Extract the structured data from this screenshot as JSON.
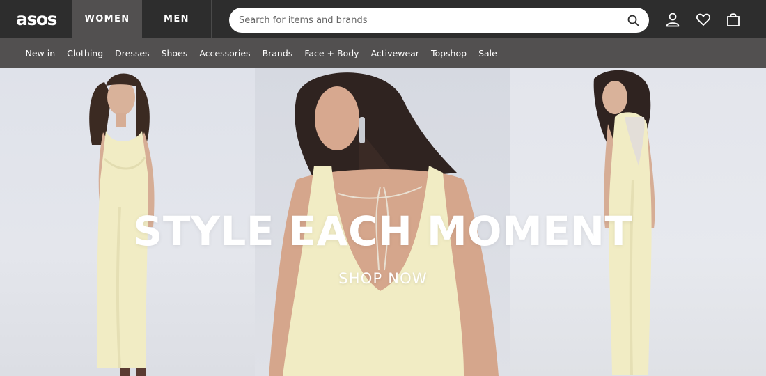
{
  "header": {
    "logo_text": "asos",
    "gender_tabs": [
      {
        "label": "WOMEN",
        "active": true
      },
      {
        "label": "MEN",
        "active": false
      }
    ],
    "search": {
      "placeholder": "Search for items and brands",
      "value": ""
    },
    "icons": [
      "search-icon",
      "account-icon",
      "heart-icon",
      "bag-icon"
    ]
  },
  "subnav": {
    "items": [
      "New in",
      "Clothing",
      "Dresses",
      "Shoes",
      "Accessories",
      "Brands",
      "Face + Body",
      "Activewear",
      "Topshop",
      "Sale"
    ]
  },
  "hero": {
    "headline": "STYLE EACH MOMENT",
    "cta": "SHOP NOW"
  },
  "colors": {
    "topbar": "#2d2d2d",
    "subnav": "#525050",
    "active_tab": "#525050",
    "dress": "#f1ecc4"
  }
}
